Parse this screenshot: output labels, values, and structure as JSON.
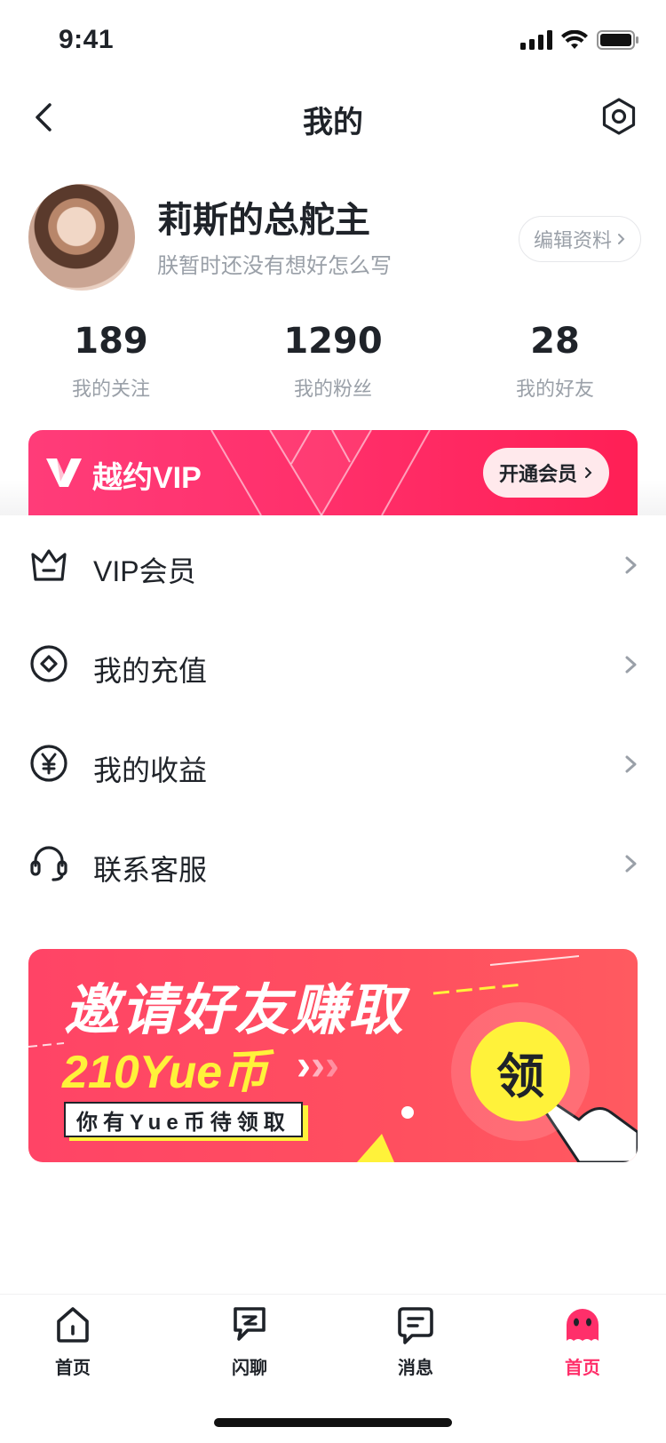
{
  "status_bar": {
    "time": "9:41"
  },
  "nav": {
    "title": "我的"
  },
  "profile": {
    "name": "莉斯的总舵主",
    "bio": "朕暂时还没有想好怎么写",
    "edit_label": "编辑资料"
  },
  "stats": [
    {
      "value": "189",
      "label": "我的关注"
    },
    {
      "value": "1290",
      "label": "我的粉丝"
    },
    {
      "value": "28",
      "label": "我的好友"
    }
  ],
  "vip_banner": {
    "title": "越约VIP",
    "button_label": "开通会员"
  },
  "menu": [
    {
      "label": "VIP会员",
      "icon": "crown-icon"
    },
    {
      "label": "我的充值",
      "icon": "recharge-icon"
    },
    {
      "label": "我的收益",
      "icon": "yen-icon"
    },
    {
      "label": "联系客服",
      "icon": "headset-icon"
    }
  ],
  "invite_banner": {
    "title": "邀请好友赚取",
    "amount": "210Yue币",
    "tag": "你有Yue币待领取",
    "claim_label": "领"
  },
  "tabbar": [
    {
      "label": "首页",
      "icon": "home-icon",
      "active": false
    },
    {
      "label": "闪聊",
      "icon": "chat-icon",
      "active": false
    },
    {
      "label": "消息",
      "icon": "message-icon",
      "active": false
    },
    {
      "label": "首页",
      "icon": "profile-ghost-icon",
      "active": true
    }
  ],
  "colors": {
    "accent": "#ff2f6a",
    "text": "#1f2329",
    "muted": "#9aa0a8",
    "highlight": "#fff23a"
  }
}
